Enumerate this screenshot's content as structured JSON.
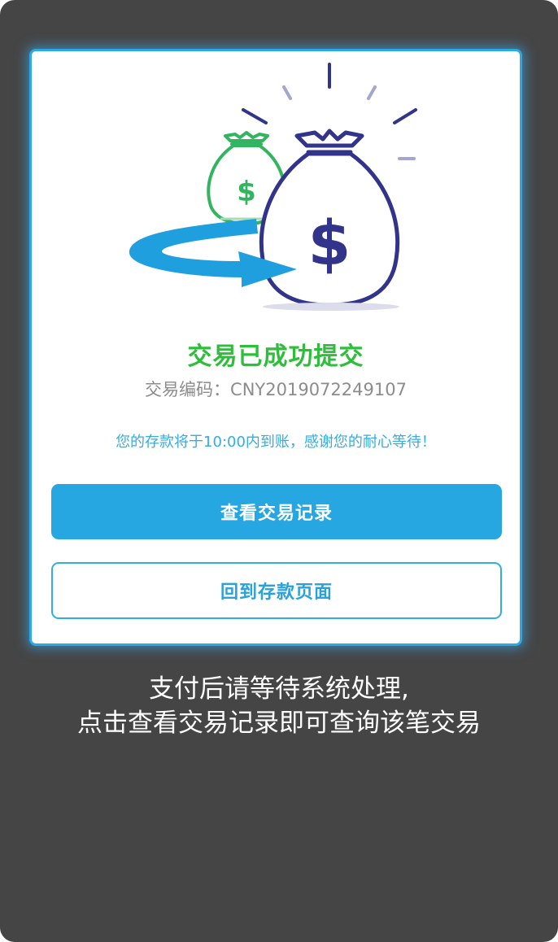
{
  "card": {
    "title": "交易已成功提交",
    "code_label": "交易编码：",
    "code_value": "CNY2019072249107",
    "notice": "您的存款将于10:00内到账，感谢您的耐心等待！"
  },
  "buttons": {
    "view_records": "查看交易记录",
    "back_to_deposit": "回到存款页面"
  },
  "caption": {
    "line1": "支付后请等待系统处理,",
    "line2": "点击查看交易记录即可查询该笔交易"
  },
  "colors": {
    "frame_background": "#454545",
    "card_border": "#29a9e5",
    "title_green": "#2fbd3c",
    "primary_blue": "#27a7e2",
    "bag_navy": "#32348c",
    "bag_green": "#33b460"
  },
  "icons": {
    "illustration": "money-bags-transfer-icon",
    "small_bag": "green-money-bag-icon",
    "large_bag": "navy-money-bag-icon",
    "arrow": "blue-curved-arrow-icon"
  }
}
